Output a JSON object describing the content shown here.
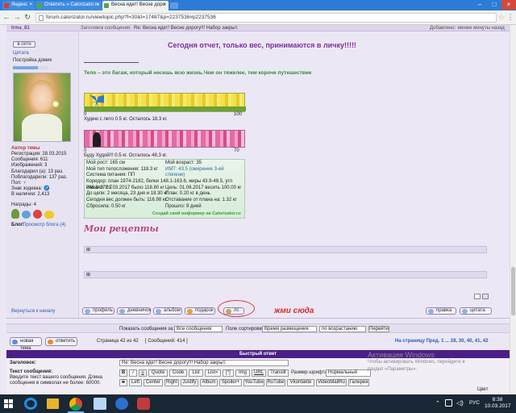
{
  "browser": {
    "tabs": [
      {
        "label": "Яндекс",
        "fav_color": "#e3372a"
      },
      {
        "label": "Ответить » Calorizator.ru",
        "fav_color": "#56a842"
      },
      {
        "label": "Весна идет! Весне доро",
        "fav_color": "#56a842"
      }
    ],
    "url": "forum.calorizator.ru/viewtopic.php?f=30&t=17487&p=2237536#p2237536"
  },
  "post": {
    "author": "Irma_81",
    "post_subject_label": "Заголовок сообщения:",
    "post_subject": "Re: Весна идет! Весне дорогу!!! Набор закрыт.",
    "added_label": "Добавлено:",
    "added_value": "менее минуты назад",
    "headline": "Сегодня отчет, только вес, принимаются в личку!!!!!",
    "motto": "Тело – это багаж, который несешь всю жизнь.Чем он тяжелее, тем короче путешествие",
    "ticker1": {
      "left": "Худею с лето 0.5 кг. Осталось 18.3 кг.",
      "right_value": "100",
      "left_value": "0"
    },
    "ticker2": {
      "left": "Буду Худой!!! 0.5 кг. Осталось 48.3 кг.",
      "right_value": "70",
      "left_value": "0"
    },
    "info_rows": [
      [
        "Мой рост: 165 см",
        "Мой возраст: 35"
      ],
      [
        "Мой тип телосложения: 118.3 кг",
        "ИМТ: 43.5 (ожирение 3-ей степени)"
      ],
      [
        "Система питания: ПП",
        ""
      ],
      [
        "Коридор: план 1974-2182, белки 148.1-163.6, жиры 43.9-48.5, угл 246.8-272.7",
        ""
      ],
      [
        "Начало: 01.03.2017 было 118.80 кг",
        "Цель: 01.06.2017 весить 100.00 кг"
      ],
      [
        "До цели: 2 месяца, 23 дня и 18.30 кг",
        "План: 0.20 кг в день"
      ],
      [
        "Сегодня вес должен быть: 116.98 кг",
        "Отставание от плана на: 1.32 кг"
      ],
      [
        "Сбросила: 0.50 кг",
        "Прошло: 9 дней"
      ]
    ],
    "info_footer": "Создай свой информер на Calorizator.ru",
    "recipes_title": "Мои рецепты",
    "collapsed_a": "",
    "collapsed_b": ""
  },
  "author_panel": {
    "offline_label": "в сети",
    "quote_label": "Цитата",
    "title_label": "Постройка домик",
    "meta_heading": "Автор темы",
    "meta": [
      "Регистрация: 28.03.2015",
      "Сообщения: 611",
      "Изображений: 3",
      "Благодарил (а): 13 раз.",
      "Поблагодарили: 137 раз.",
      "Пол: ♀",
      "Знак зодиака: ♐",
      "В наличии: 2,413"
    ],
    "awards_label": "Награды: 4",
    "blog_label": "Блог:",
    "blog_link": "Просмотр блога (4)"
  },
  "actions": {
    "back_to_top": "Вернуться к началу",
    "profile": "профиль",
    "diary": "дневничок",
    "album": "альбом",
    "gift": "подарок",
    "pm": "лс",
    "annotation": "жми сюда",
    "edit": "правка",
    "quote": "цитата"
  },
  "sortbar": {
    "show_label": "Показать сообщения за:",
    "show_value": "Все сообщения",
    "sort_label": "Поле сортировки",
    "sort_value": "Время размещения",
    "order_value": "по возрастанию",
    "go": "Перейти"
  },
  "pager": {
    "new_topic": "новая тема",
    "reply": "ответить",
    "page_text": "Страница 42 из 42",
    "messages": "[ Сообщений: 414 ]",
    "goto_label": "На страницу Пред. 1 ... 28, 30, 40, 41, 42"
  },
  "quick_reply": {
    "title": "Быстрый ответ",
    "subject_label": "Заголовок:",
    "subject_value": "Re: Весна идет! Весне дорогу!!! Набор закрыт.",
    "text_label": "Текст сообщения:",
    "text_hint": "Введите текст вашего сообщения. Длина сообщения в символах не более: 60000.",
    "buttons_row1": [
      "B",
      "i",
      "u",
      "Quote",
      "Code",
      "List",
      "List=",
      "[*]",
      "Img",
      "URL",
      "Translit"
    ],
    "font_size_label": "Размер шрифта:",
    "font_size_value": "Нормальный",
    "buttons_row2": [
      "S",
      "Left",
      "Center",
      "Right",
      "Justify",
      "Album",
      "Spoiler+",
      "YouTube",
      "RuTube",
      "Vkontakte",
      "VideoMailRu",
      "Галерея"
    ],
    "color_label": "Цвет"
  },
  "watermark": {
    "line1": "Активация Windows",
    "line2": "Чтобы активировать Windows, перейдите в",
    "line3": "раздел «Параметры»."
  },
  "taskbar": {
    "lang": "РУС",
    "time": "8:38",
    "date": "10.03.2017"
  }
}
